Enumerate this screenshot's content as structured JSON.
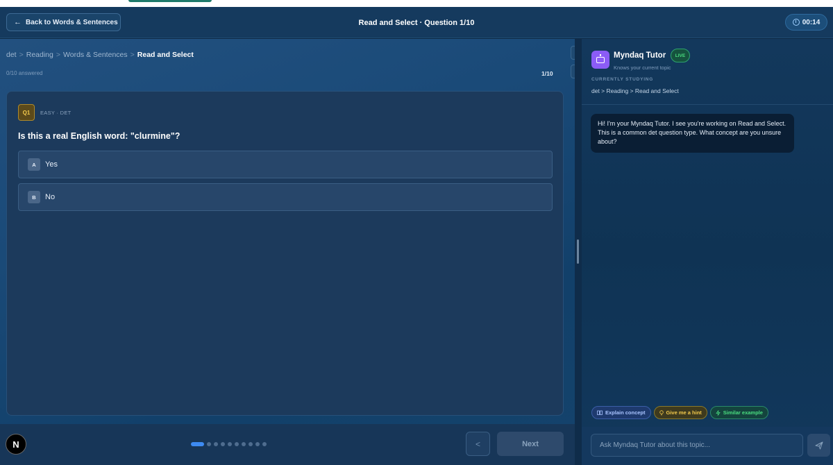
{
  "topbar": {
    "back_label": "Back to Words & Sentences",
    "title": "Read and Select · Question 1/10",
    "timer": "00:14"
  },
  "breadcrumb": {
    "items": [
      "det",
      "Reading",
      "Words & Sentences"
    ],
    "current": "Read and Select"
  },
  "progress": {
    "answered": "0/10 answered",
    "counter": "1/10",
    "current_index": 1,
    "total": 10
  },
  "question": {
    "badge": "Q1",
    "meta": "EASY · DET",
    "text": "Is this a real English word: \"clurmine\"?",
    "options": [
      {
        "letter": "A",
        "label": "Yes"
      },
      {
        "letter": "B",
        "label": "No"
      }
    ]
  },
  "footer": {
    "logo": "N",
    "next_label": "Next"
  },
  "tutor": {
    "name": "Myndaq Tutor",
    "live": "LIVE",
    "subtitle": "Knows your current topic",
    "studying_label": "CURRENTLY STUDYING",
    "studying_path": "det > Reading > Read and Select",
    "message": "Hi! I'm your Myndaq Tutor. I see you're working on Read and Select. This is a common det question type. What concept are you unsure about?",
    "chips": [
      {
        "label": "Explain concept",
        "icon": "book-icon"
      },
      {
        "label": "Give me a hint",
        "icon": "lightbulb-icon"
      },
      {
        "label": "Similar example",
        "icon": "sparkle-icon"
      }
    ],
    "input_placeholder": "Ask Myndaq Tutor about this topic..."
  },
  "colors": {
    "accent": "#3d8bf2",
    "live": "#4ade80",
    "tutor_avatar": "#8b5cf6",
    "badge": "#f2c94c"
  }
}
